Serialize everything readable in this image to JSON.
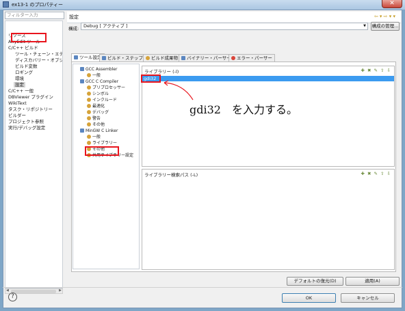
{
  "window": {
    "title": "ex13-1 のプロパティー",
    "close_symbol": "✕"
  },
  "filter": {
    "placeholder": "フィルター入力"
  },
  "nav": {
    "items": [
      "リソース",
      "AnyEdit ツール",
      "C/C++ ビルド",
      "ツール・チェーン・エディター",
      "ディスカバリー・オプション",
      "ビルド変数",
      "ロギング",
      "環境",
      "設定",
      "C/C++ 一般",
      "DBViewer プラグイン",
      "WikiText",
      "タスク・リポジトリー",
      "ビルダー",
      "プロジェクト参照",
      "実行/デバッグ設定"
    ]
  },
  "page": {
    "title": "設定",
    "history_icons": "⇦ ▾ ⇨ ▾ ▾"
  },
  "config": {
    "label": "構成:",
    "value": "Debug [ アクティブ ]",
    "manage_button": "構成の管理..."
  },
  "tabs": [
    {
      "label": "ツール設定",
      "active": true
    },
    {
      "label": "ビルド・ステップ"
    },
    {
      "label": "ビルド成果物"
    },
    {
      "label": "バイナリー・パーサー"
    },
    {
      "label": "エラー・パーサー"
    }
  ],
  "tool_tree": [
    "GCC Assembler",
    "一般",
    "GCC C Compiler",
    "プリプロセッサー",
    "シンボル",
    "インクルード",
    "最適化",
    "デバッグ",
    "警告",
    "その他",
    "MinGW C Linker",
    "一般",
    "ライブラリー",
    "その他",
    "共用ライブラリー設定"
  ],
  "libraries": {
    "title": "ライブラリー (-l)",
    "items": [
      "gdi32"
    ]
  },
  "library_paths": {
    "title": "ライブラリー検索パス (-L)"
  },
  "annotation": {
    "text": "gdi32　を入力する。"
  },
  "buttons": {
    "restore_defaults": "デフォルトの復元(D)",
    "apply": "適用(A)",
    "ok": "OK",
    "cancel": "キャンセル"
  },
  "colors": {
    "highlight": "#e8141c",
    "selection": "#3b9bf0"
  }
}
